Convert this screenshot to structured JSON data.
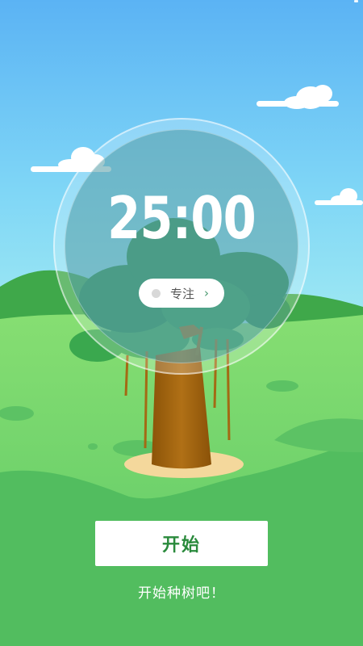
{
  "timer": {
    "display": "25:00"
  },
  "mode": {
    "label": "专注",
    "chevron": "›"
  },
  "actions": {
    "start_label": "开始"
  },
  "hint": "开始种树吧！",
  "colors": {
    "sky_top": "#5fb6f5",
    "sky_bottom": "#8ee6f5",
    "grass": "#6fd46a",
    "grass_dark": "#52bb5e",
    "trunk": "#a86a12",
    "button_text": "#2a8a3c"
  },
  "icons": {
    "mode_indicator": "dot-icon",
    "mode_more": "chevron-right-icon"
  }
}
